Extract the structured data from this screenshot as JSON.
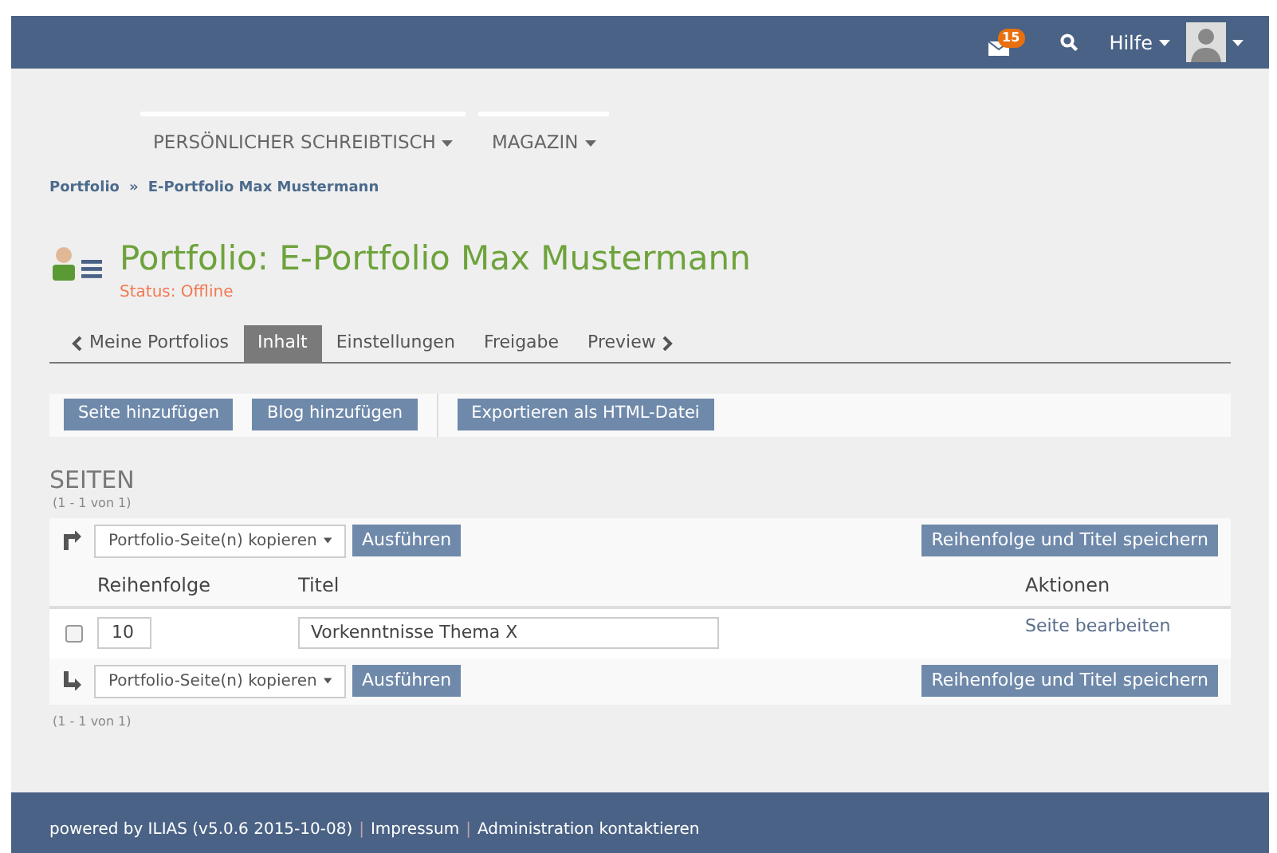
{
  "header": {
    "mail_badge": "15",
    "help": "Hilfe"
  },
  "main_menu": [
    {
      "label": "PERSÖNLICHER SCHREIBTISCH"
    },
    {
      "label": "MAGAZIN"
    }
  ],
  "breadcrumb": {
    "items": [
      "Portfolio",
      "E-Portfolio Max Mustermann"
    ],
    "separator": "»"
  },
  "title": "Portfolio: E-Portfolio Max Mustermann",
  "status": "Status: Offline",
  "tabs": [
    {
      "label": "Meine Portfolios",
      "kind": "back",
      "selected": false
    },
    {
      "label": "Inhalt",
      "kind": "plain",
      "selected": true
    },
    {
      "label": "Einstellungen",
      "kind": "plain",
      "selected": false
    },
    {
      "label": "Freigabe",
      "kind": "plain",
      "selected": false
    },
    {
      "label": "Preview",
      "kind": "forward",
      "selected": false
    }
  ],
  "toolbar": [
    [
      "Seite hinzufügen",
      "Blog hinzufügen"
    ],
    [
      "Exportieren als HTML-Datei"
    ]
  ],
  "section_title": "SEITEN",
  "count_top": "(1 - 1 von 1)",
  "top_actions": {
    "select": "Portfolio-Seite(n) kopieren",
    "run": "Ausführen",
    "save": "Reihenfolge und Titel speichern"
  },
  "table": {
    "columns": [
      "Reihenfolge",
      "Titel",
      "Aktionen"
    ],
    "rows": [
      {
        "checked": false,
        "order": "10",
        "title": "Vorkenntnisse Thema X",
        "action": "Seite bearbeiten"
      }
    ]
  },
  "bottom_actions": {
    "select": "Portfolio-Seite(n) kopieren",
    "run": "Ausführen",
    "save": "Reihenfolge und Titel speichern"
  },
  "count_bottom": "(1 - 1 von 1)",
  "footer": [
    {
      "kind": "text",
      "text": "powered by ILIAS (v5.0.6 2015-10-08)"
    },
    {
      "kind": "separator",
      "text": "|"
    },
    {
      "kind": "link",
      "text": "Impressum"
    },
    {
      "kind": "separator",
      "text": "|"
    },
    {
      "kind": "link",
      "text": "Administration kontaktieren"
    }
  ]
}
